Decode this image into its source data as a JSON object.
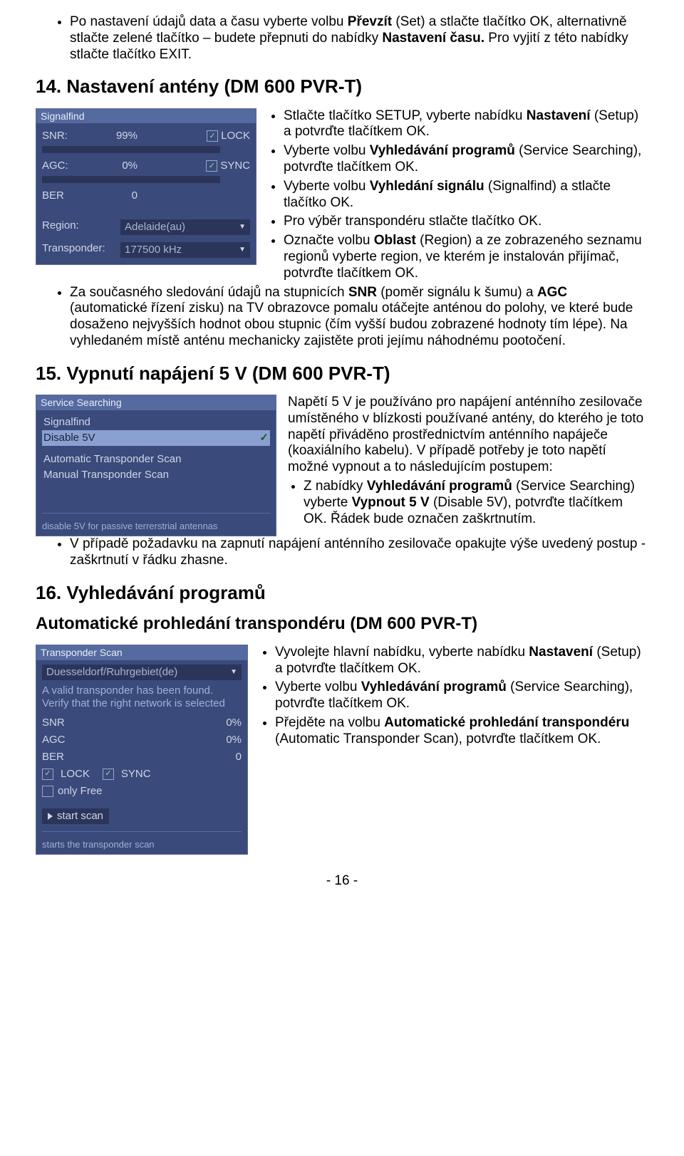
{
  "intro_bullet_html": "Po nastavení údajů data a času vyberte volbu <b>Převzít</b> (Set) a stlačte tlačítko OK, alternativně stlačte zelené tlačítko – budete přepnuti do nabídky <b>Nastavení času.</b> Pro vyjití z této nabídky stlačte tlačítko EXIT.",
  "h14": "14.  Nastavení antény (DM 600 PVR-T)",
  "shot1": {
    "title": "Signalfind",
    "snr_label": "SNR:",
    "snr_val": "99%",
    "lock": "LOCK",
    "agc_label": "AGC:",
    "agc_val": "0%",
    "sync": "SYNC",
    "ber_label": "BER",
    "ber_val": "0",
    "region_label": "Region:",
    "region_val": "Adelaide(au)",
    "tr_label": "Transponder:",
    "tr_val": "177500 kHz"
  },
  "sec14_side_bullets_html": [
    "Stlačte tlačítko SETUP, vyberte nabídku <b>Nastavení</b> (Setup) a potvrďte tlačítkem OK.",
    "Vyberte volbu <b>Vyhledávání programů</b> (Service Searching), potvrďte tlačítkem OK.",
    "Vyberte volbu <b>Vyhledání signálu</b> (Signalfind) a stlačte tlačítko OK.",
    "Pro výběr transpondéru stlačte tlačítko OK.",
    "Označte volbu <b>Oblast</b> (Region) a ze zobrazeného seznamu regionů vyberte region, ve kterém je instalován přijímač, potvrďte tlačítkem OK."
  ],
  "sec14_full_bullet_html": "Za současného sledování údajů na stupnicích <b>SNR</b> (poměr signálu k šumu) a <b>AGC</b> (automatické řízení zisku) na TV obrazovce pomalu otáčejte anténou do polohy, ve které bude dosaženo nejvyšších hodnot obou stupnic (čím vyšší budou zobrazené hodnoty tím lépe). Na vyhledaném místě anténu mechanicky zajistěte proti jejímu náhodnému pootočení.",
  "h15": "15.  Vypnutí napájení 5 V (DM 600 PVR-T)",
  "shot2": {
    "title": "Service Searching",
    "item1": "Signalfind",
    "item2": "Disable 5V",
    "item3": "Automatic Transponder Scan",
    "item4": "Manual Transponder Scan",
    "hint": "disable 5V for passive terrerstrial antennas"
  },
  "sec15_intro": "Napětí 5 V je používáno pro napájení anténního zesilovače umístěného v blízkosti používané antény, do kterého je toto napětí přiváděno prostřednictvím anténního napáječe (koaxiálního kabelu). V případě potřeby je toto napětí možné vypnout a to následujícím postupem:",
  "sec15_sub_bullet_html": "Z nabídky <b>Vyhledávání programů</b> (Service Searching) vyberte <b>Vypnout 5 V</b> (Disable 5V), potvrďte tlačítkem OK. Řádek bude označen zaškrtnutím.",
  "sec15_full_bullet_html": "V případě požadavku na zapnutí napájení anténního zesilovače opakujte výše uvedený postup - zaškrtnutí v řádku zhasne.",
  "h16": "16.  Vyhledávání programů",
  "h16_sub": "Automatické prohledání transpondéru (DM 600 PVR-T)",
  "shot3": {
    "title": "Transponder Scan",
    "sel": "Duesseldorf/Ruhrgebiet(de)",
    "msg": "A valid transponder has been found. Verify that the right network is selected",
    "snr": "SNR",
    "agc": "AGC",
    "ber": "BER",
    "pct": "0%",
    "zero": "0",
    "lock": "LOCK",
    "sync": "SYNC",
    "onlyfree": "only Free",
    "start": "start scan",
    "hint": "starts the transponder scan"
  },
  "sec16_side_bullets_html": [
    "Vyvolejte hlavní nabídku, vyberte nabídku <b>Nastavení</b> (Setup) a potvrďte tlačítkem OK.",
    "Vyberte volbu <b>Vyhledávání programů</b> (Service Searching), potvrďte tlačítkem OK.",
    "Přejděte na volbu <b>Automatické prohledání transpondéru</b> (Automatic Transponder Scan), potvrďte tlačítkem OK."
  ],
  "page_number": "- 16 -"
}
